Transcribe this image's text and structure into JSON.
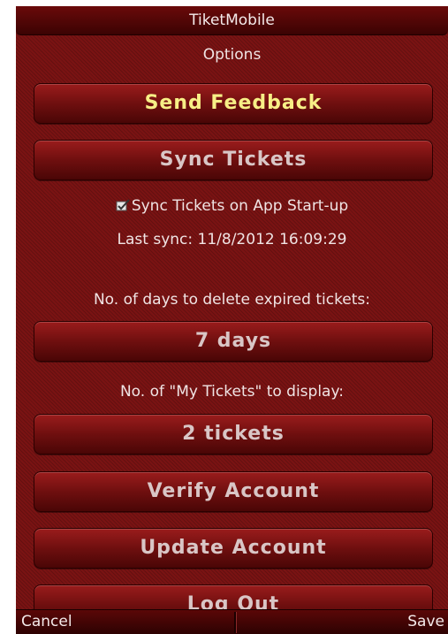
{
  "app": {
    "title": "TiketMobile"
  },
  "screen": {
    "heading": "Options"
  },
  "buttons": {
    "send_feedback": "Send Feedback",
    "sync_tickets": "Sync Tickets",
    "days": "7 days",
    "my_tickets": "2 tickets",
    "verify_account": "Verify Account",
    "update_account": "Update Account",
    "log_out": "Log Out"
  },
  "sync": {
    "checkbox_label": "Sync Tickets on App Start-up",
    "checked": true,
    "last_sync": "Last sync: 11/8/2012 16:09:29"
  },
  "labels": {
    "expired_days": "No. of days to delete expired tickets:",
    "my_tickets": "No. of \"My Tickets\" to display:"
  },
  "softkeys": {
    "left": "Cancel",
    "right": "Save"
  },
  "colors": {
    "background": "#7a1313",
    "highlight_text": "#f7ef86",
    "button_text": "#d9c6c6"
  }
}
